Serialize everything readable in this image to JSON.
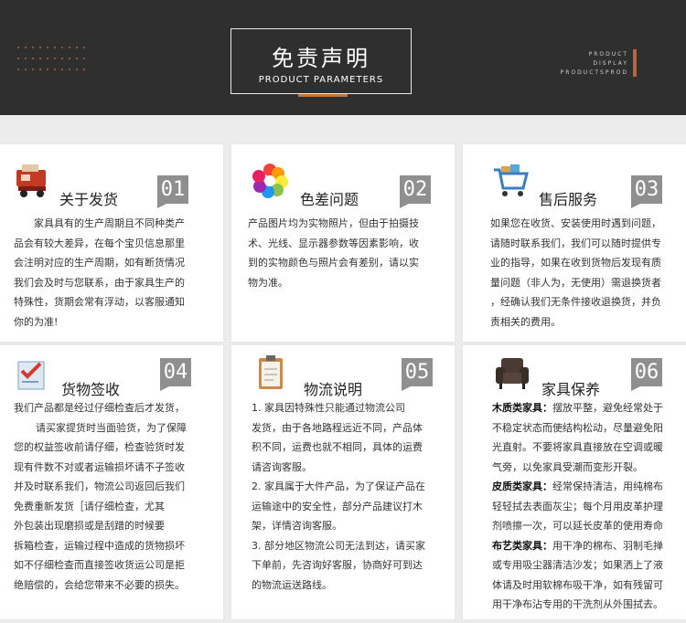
{
  "header": {
    "title": "免责声明",
    "subtitle": "PRODUCT PARAMETERS",
    "side_label": [
      "PRODUCT",
      "DISPLAY",
      "PRODUCTSPROD"
    ]
  },
  "cards": [
    {
      "number": "01",
      "title": "关于发货",
      "icon": "delivery-truck-icon",
      "lines": [
        "家具具有的生产周期且不同种类产",
        "品会有较大差异，在每个宝贝信息那里",
        "会注明对应的生产周期，如有断货情况",
        "我们会及时与您联系，由于家具生产的",
        "特殊性，货期会常有浮动，以客服通知",
        "你的为准!"
      ]
    },
    {
      "number": "02",
      "title": "色差问题",
      "icon": "color-palette-icon",
      "lines": [
        "产品图片均为实物照片，但由于拍摄技",
        "术、光线、显示器参数等因素影响，收",
        "到的实物颜色与照片会有差别，请以实",
        "物为准。"
      ]
    },
    {
      "number": "03",
      "title": "售后服务",
      "icon": "shopping-cart-icon",
      "lines": [
        "如果您在收货、安装使用时遇到问题，",
        "请随时联系我们，我们可以随时提供专",
        "业的指导，如果在收到货物后发现有质",
        "量问题（非人为，无使用）需退换货者",
        "，经确认我们无条件接收退换货，并负",
        "责相关的费用。"
      ]
    },
    {
      "number": "04",
      "title": "货物签收",
      "icon": "sign-checklist-icon",
      "lines": [
        "我们产品都是经过仔细检查后才发货，",
        "请买家提货时当面验货，为了保障",
        "您的权益签收前请仔细，检查验货时发",
        "现有件数不对或者运输损坏请不子签收",
        "并及时联系我们，物流公司返回后我们",
        "免费重新发货［请仔细检查，尤其",
        "外包装出现磨损或是刮蹭的时候要",
        "拆箱检查，运输过程中造成的货物损坏",
        "如不仔细检查而直接签收货运公司是拒",
        "绝赔偿的，会给您带来不必要的损失。"
      ]
    },
    {
      "number": "05",
      "title": "物流说明",
      "icon": "clipboard-icon",
      "lines": [
        "1. 家具因特殊性只能通过物流公司",
        "发货，由于各地路程远近不同，产品体",
        "积不同，运费也就不相同，具体的运费",
        "请咨询客服。",
        "2. 家具属于大件产品，为了保证产品在",
        "运输途中的安全性，部分产品建议打木",
        "架，详情咨询客服。",
        "3. 部分地区物流公司无法到达，请买家",
        "下单前，先咨询好客服，协商好可到达",
        "的物流运送路线。"
      ]
    },
    {
      "number": "06",
      "title": "家具保养",
      "icon": "armchair-icon",
      "lines": [
        "木质类家具：摆放平整，避免经常处于",
        "不稳定状态而使结构松动，尽量避免阳",
        "光直射。不要将家具直接放在空调或暖",
        "气旁，以免家具受潮而变形开裂。",
        "皮质类家具：经常保持清洁，用纯棉布",
        "轻轻拭去表面灰尘；每个月用皮革护理",
        "剂喷擦一次，可以延长皮革的使用寿命",
        "布艺类家具：用干净的棉布、羽制毛掸",
        "或专用吸尘器清洁沙发；如果洒上了液",
        "体请及时用软棉布吸干净，如有残留可",
        "用干净布沾专用的干洗剂从外围拭去。"
      ]
    }
  ]
}
